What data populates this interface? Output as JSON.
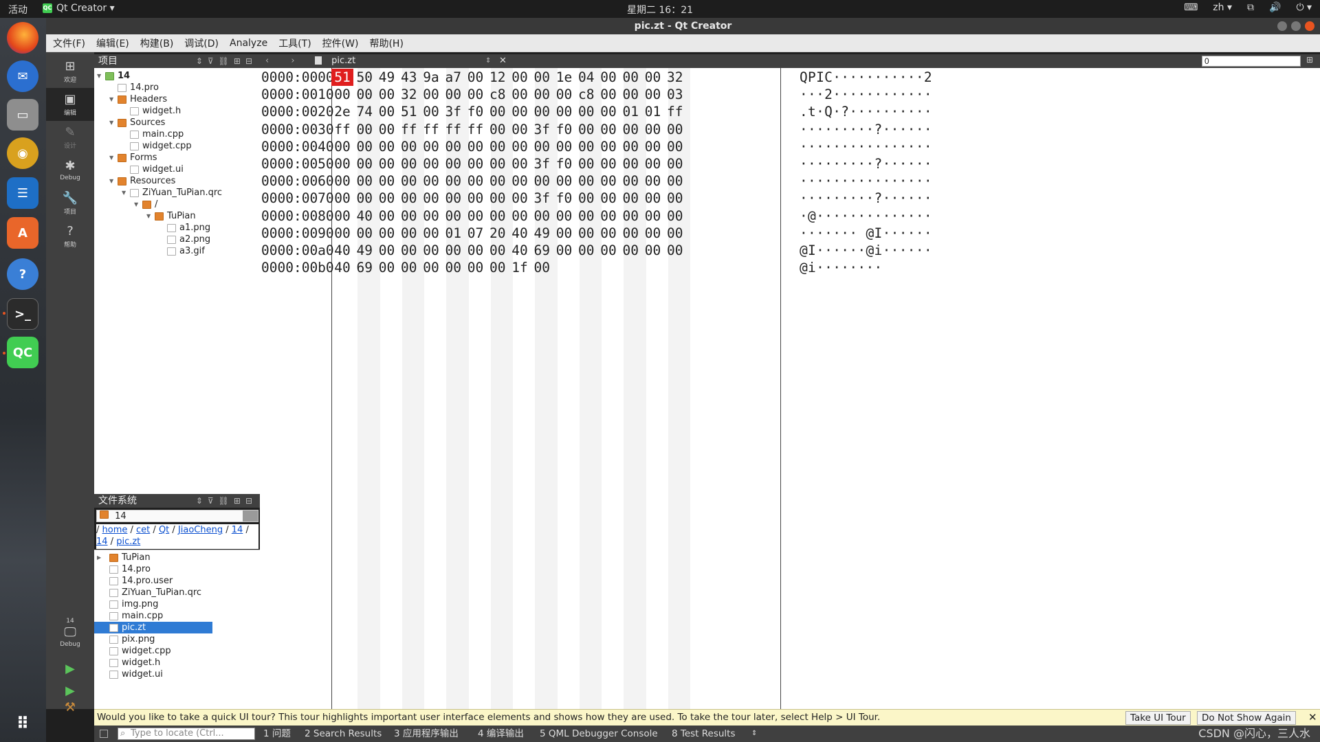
{
  "topbar": {
    "activities": "活动",
    "app_name": "Qt Creator ▾",
    "clock": "星期二 16：21",
    "lang": "zh ▾"
  },
  "window": {
    "title": "pic.zt - Qt Creator"
  },
  "menubar": {
    "items": [
      "文件(F)",
      "编辑(E)",
      "构建(B)",
      "调试(D)",
      "Analyze",
      "工具(T)",
      "控件(W)",
      "帮助(H)"
    ]
  },
  "modes": {
    "welcome": "欢迎",
    "edit": "编辑",
    "design": "设计",
    "debug": "Debug",
    "projects": "项目",
    "help": "帮助",
    "kit_project": "14",
    "kit_mode": "Debug"
  },
  "projects_panel": {
    "title": "项目",
    "tree": [
      {
        "label": "14",
        "depth": 0,
        "expanded": true,
        "icon": "project-folder-icon",
        "bold": true
      },
      {
        "label": "14.pro",
        "depth": 1,
        "icon": "pro-file-icon"
      },
      {
        "label": "Headers",
        "depth": 1,
        "expanded": true,
        "icon": "folder-icon"
      },
      {
        "label": "widget.h",
        "depth": 2,
        "icon": "header-file-icon"
      },
      {
        "label": "Sources",
        "depth": 1,
        "expanded": true,
        "icon": "folder-icon"
      },
      {
        "label": "main.cpp",
        "depth": 2,
        "icon": "cpp-file-icon"
      },
      {
        "label": "widget.cpp",
        "depth": 2,
        "icon": "cpp-file-icon"
      },
      {
        "label": "Forms",
        "depth": 1,
        "expanded": true,
        "icon": "folder-icon"
      },
      {
        "label": "widget.ui",
        "depth": 2,
        "icon": "ui-file-icon"
      },
      {
        "label": "Resources",
        "depth": 1,
        "expanded": true,
        "icon": "folder-icon"
      },
      {
        "label": "ZiYuan_TuPian.qrc",
        "depth": 2,
        "expanded": true,
        "icon": "qrc-file-icon"
      },
      {
        "label": "/",
        "depth": 3,
        "expanded": true,
        "icon": "folder-icon"
      },
      {
        "label": "TuPian",
        "depth": 4,
        "expanded": true,
        "icon": "folder-icon"
      },
      {
        "label": "a1.png",
        "depth": 5,
        "icon": "image-file-icon"
      },
      {
        "label": "a2.png",
        "depth": 5,
        "icon": "image-file-icon"
      },
      {
        "label": "a3.gif",
        "depth": 5,
        "icon": "image-file-icon"
      }
    ]
  },
  "filesystem_panel": {
    "title": "文件系统",
    "combo_value": "14",
    "breadcrumb": [
      "home",
      "cet",
      "Qt",
      "JiaoCheng",
      "14",
      "14",
      "pic.zt"
    ],
    "files": [
      {
        "label": "TuPian",
        "icon": "folder-icon",
        "expandable": true
      },
      {
        "label": "14.pro",
        "icon": "pro-file-icon"
      },
      {
        "label": "14.pro.user",
        "icon": "file-icon"
      },
      {
        "label": "ZiYuan_TuPian.qrc",
        "icon": "qrc-file-icon"
      },
      {
        "label": "img.png",
        "icon": "file-icon"
      },
      {
        "label": "main.cpp",
        "icon": "cpp-file-icon"
      },
      {
        "label": "pic.zt",
        "icon": "file-icon",
        "selected": true
      },
      {
        "label": "pix.png",
        "icon": "file-icon"
      },
      {
        "label": "widget.cpp",
        "icon": "cpp-file-icon"
      },
      {
        "label": "widget.h",
        "icon": "header-file-icon"
      },
      {
        "label": "widget.ui",
        "icon": "ui-file-icon"
      }
    ]
  },
  "editor": {
    "file_name": "pic.zt",
    "goto_value": "0",
    "highlight_color": "#e01e1e",
    "rows": [
      {
        "addr": "0000:0000",
        "bytes": [
          "51",
          "50",
          "49",
          "43",
          "9a",
          "a7",
          "00",
          "12",
          "00",
          "00",
          "1e",
          "04",
          "00",
          "00",
          "00",
          "32"
        ],
        "ascii": "QPIC···········2"
      },
      {
        "addr": "0000:0010",
        "bytes": [
          "00",
          "00",
          "00",
          "32",
          "00",
          "00",
          "00",
          "c8",
          "00",
          "00",
          "00",
          "c8",
          "00",
          "00",
          "00",
          "03"
        ],
        "ascii": "···2············"
      },
      {
        "addr": "0000:0020",
        "bytes": [
          "2e",
          "74",
          "00",
          "51",
          "00",
          "3f",
          "f0",
          "00",
          "00",
          "00",
          "00",
          "00",
          "00",
          "01",
          "01",
          "ff"
        ],
        "ascii": ".t·Q·?··········"
      },
      {
        "addr": "0000:0030",
        "bytes": [
          "ff",
          "00",
          "00",
          "ff",
          "ff",
          "ff",
          "ff",
          "00",
          "00",
          "3f",
          "f0",
          "00",
          "00",
          "00",
          "00",
          "00"
        ],
        "ascii": "·········?······"
      },
      {
        "addr": "0000:0040",
        "bytes": [
          "00",
          "00",
          "00",
          "00",
          "00",
          "00",
          "00",
          "00",
          "00",
          "00",
          "00",
          "00",
          "00",
          "00",
          "00",
          "00"
        ],
        "ascii": "················"
      },
      {
        "addr": "0000:0050",
        "bytes": [
          "00",
          "00",
          "00",
          "00",
          "00",
          "00",
          "00",
          "00",
          "00",
          "3f",
          "f0",
          "00",
          "00",
          "00",
          "00",
          "00"
        ],
        "ascii": "·········?······"
      },
      {
        "addr": "0000:0060",
        "bytes": [
          "00",
          "00",
          "00",
          "00",
          "00",
          "00",
          "00",
          "00",
          "00",
          "00",
          "00",
          "00",
          "00",
          "00",
          "00",
          "00"
        ],
        "ascii": "················"
      },
      {
        "addr": "0000:0070",
        "bytes": [
          "00",
          "00",
          "00",
          "00",
          "00",
          "00",
          "00",
          "00",
          "00",
          "3f",
          "f0",
          "00",
          "00",
          "00",
          "00",
          "00"
        ],
        "ascii": "·········?······"
      },
      {
        "addr": "0000:0080",
        "bytes": [
          "00",
          "40",
          "00",
          "00",
          "00",
          "00",
          "00",
          "00",
          "00",
          "00",
          "00",
          "00",
          "00",
          "00",
          "00",
          "00"
        ],
        "ascii": "·@··············"
      },
      {
        "addr": "0000:0090",
        "bytes": [
          "00",
          "00",
          "00",
          "00",
          "00",
          "01",
          "07",
          "20",
          "40",
          "49",
          "00",
          "00",
          "00",
          "00",
          "00",
          "00"
        ],
        "ascii": "······· @I······"
      },
      {
        "addr": "0000:00a0",
        "bytes": [
          "40",
          "49",
          "00",
          "00",
          "00",
          "00",
          "00",
          "00",
          "40",
          "69",
          "00",
          "00",
          "00",
          "00",
          "00",
          "00"
        ],
        "ascii": "@I······@i······"
      },
      {
        "addr": "0000:00b0",
        "bytes": [
          "40",
          "69",
          "00",
          "00",
          "00",
          "00",
          "00",
          "00",
          "1f",
          "00"
        ],
        "ascii": "@i········"
      }
    ]
  },
  "tour": {
    "message": "Would you like to take a quick UI tour? This tour highlights important user interface elements and shows how they are used. To take the tour later, select Help > UI Tour.",
    "take_label": "Take UI Tour",
    "dismiss_label": "Do Not Show Again",
    "close_label": "✕"
  },
  "statusbar": {
    "locator_placeholder": "Type to locate (Ctrl...",
    "tabs": [
      "1 问题",
      "2 Search Results",
      "3 应用程序输出",
      "4 编译输出",
      "5 QML Debugger Console",
      "8 Test Results"
    ],
    "watermark": "CSDN @闪心，三人水"
  }
}
